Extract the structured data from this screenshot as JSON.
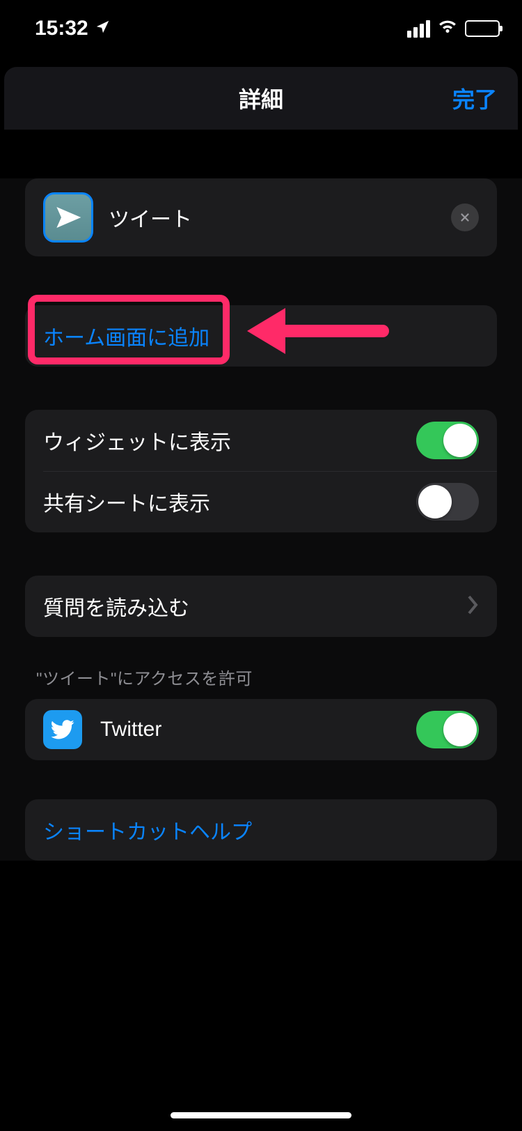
{
  "status": {
    "time": "15:32"
  },
  "nav": {
    "title": "詳細",
    "done": "完了"
  },
  "shortcut": {
    "name": "ツイート"
  },
  "actions": {
    "add_to_home": "ホーム画面に追加"
  },
  "display": {
    "show_in_widget": {
      "label": "ウィジェットに表示",
      "on": true
    },
    "show_in_share_sheet": {
      "label": "共有シートに表示",
      "on": false
    }
  },
  "import_questions": {
    "label": "質問を読み込む"
  },
  "access": {
    "header": "\"ツイート\"にアクセスを許可",
    "twitter": {
      "label": "Twitter",
      "on": true
    }
  },
  "help": {
    "label": "ショートカットヘルプ"
  },
  "colors": {
    "accent": "#0a84ff",
    "toggle_on": "#34c759",
    "annotation": "#ff2a68"
  }
}
